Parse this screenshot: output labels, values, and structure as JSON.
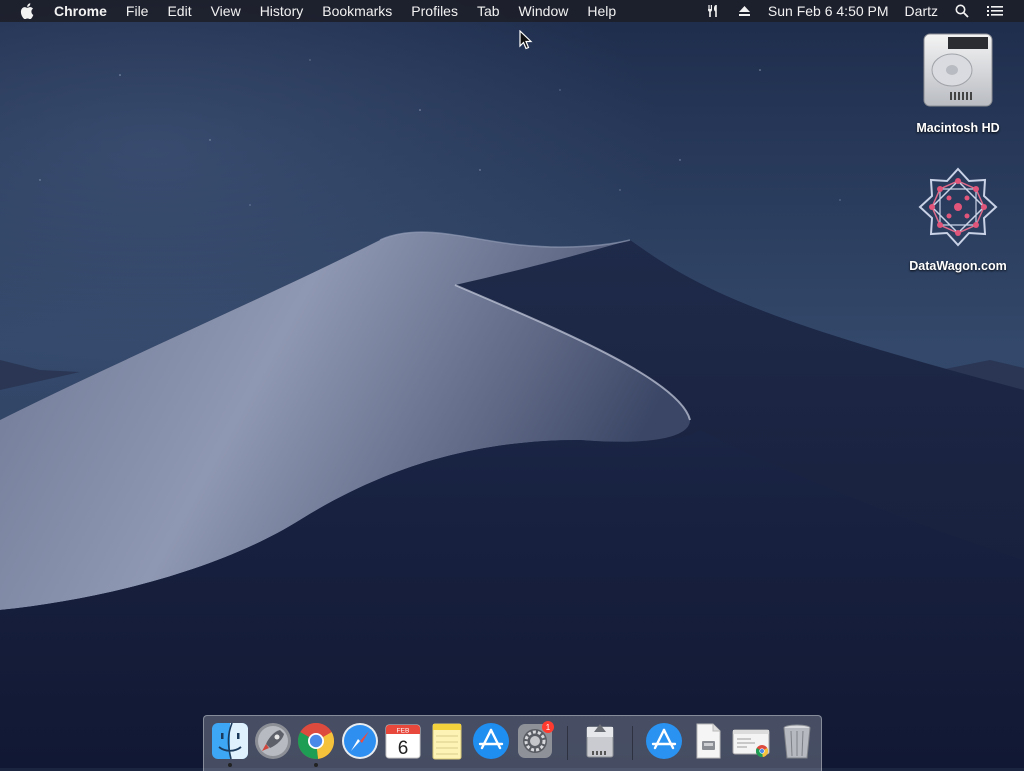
{
  "menubar": {
    "app_name": "Chrome",
    "menus": [
      "File",
      "Edit",
      "View",
      "History",
      "Bookmarks",
      "Profiles",
      "Tab",
      "Window",
      "Help"
    ],
    "clock": "Sun Feb 6  4:50 PM",
    "user": "Dartz",
    "icons": [
      "apple-icon",
      "tools-icon",
      "eject-icon",
      "search-icon",
      "list-icon"
    ]
  },
  "desktop": {
    "icons": [
      {
        "label": "Macintosh HD",
        "icon": "hard-drive-icon"
      },
      {
        "label": "DataWagon.com",
        "icon": "star-network-icon"
      }
    ]
  },
  "dock": {
    "items": [
      {
        "name": "finder",
        "running": true
      },
      {
        "name": "launchpad",
        "running": false
      },
      {
        "name": "chrome",
        "running": true
      },
      {
        "name": "safari",
        "running": false
      },
      {
        "name": "calendar",
        "running": false,
        "month": "FEB",
        "day": "6"
      },
      {
        "name": "notes",
        "running": false
      },
      {
        "name": "app-store",
        "running": false
      },
      {
        "name": "system-preferences",
        "running": false,
        "badge": "1"
      },
      {
        "name": "disk-utility",
        "running": false
      },
      {
        "name": "app-store-folder",
        "running": false
      },
      {
        "name": "document",
        "running": false
      },
      {
        "name": "chrome-window",
        "running": false
      },
      {
        "name": "trash",
        "running": false
      }
    ]
  },
  "colors": {
    "menubar_bg": "#1c1e28",
    "sky_top": "#1d2a47",
    "dune_light": "#8a93ad",
    "dune_dark": "#1a2444",
    "badge": "#ff3b30"
  }
}
